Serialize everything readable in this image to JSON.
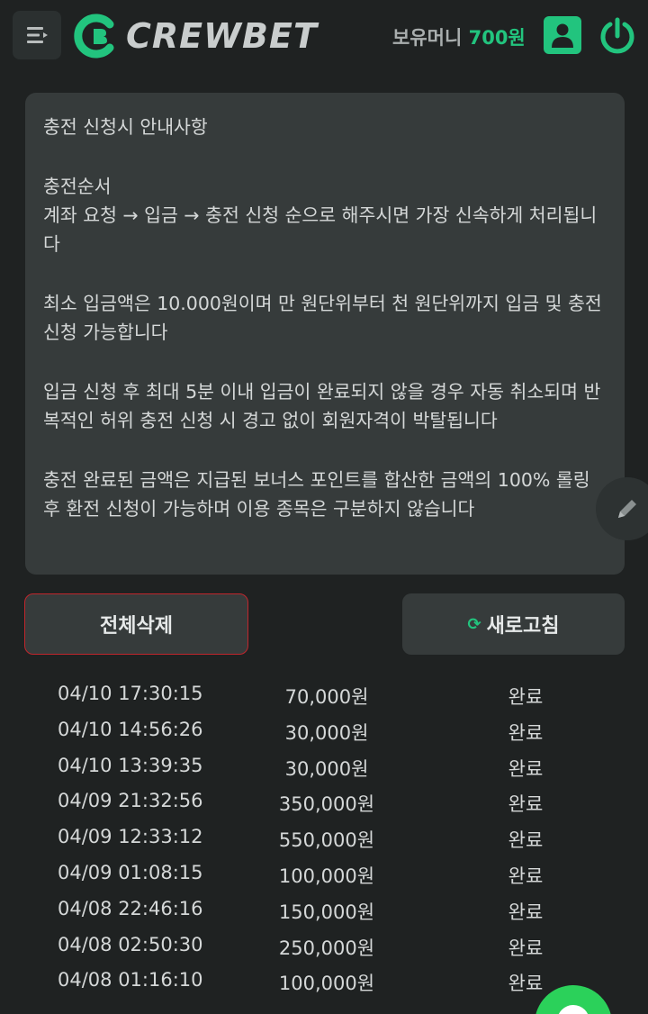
{
  "header": {
    "logo_text": "CREWBET",
    "balance_label": "보유머니",
    "balance_amount": "700원"
  },
  "notice": {
    "title": "충전 신청시 안내사항",
    "section1_title": "충전순서",
    "section1_body": "계좌 요청 → 입금 → 충전 신청 순으로 해주시면 가장 신속하게 처리됩니다",
    "section2_body": "최소 입금액은 10.000원이며 만 원단위부터 천 원단위까지 입금 및 충전 신청 가능합니다",
    "section3_body": "입금 신청 후 최대 5분 이내 입금이 완료되지 않을 경우 자동 취소되며 반복적인 허위 충전 신청 시 경고 없이 회원자격이 박탈됩니다",
    "section4_body": "충전 완료된 금액은 지급된 보너스 포인트를 합산한 금액의 100% 롤링 후 환전 신청이 가능하며 이용 종목은 구분하지 않습니다"
  },
  "actions": {
    "delete_all_label": "전체삭제",
    "refresh_label": "새로고침"
  },
  "history": [
    {
      "time": "04/10 17:30:15",
      "amount": "70,000원",
      "status": "완료"
    },
    {
      "time": "04/10 14:56:26",
      "amount": "30,000원",
      "status": "완료"
    },
    {
      "time": "04/10 13:39:35",
      "amount": "30,000원",
      "status": "완료"
    },
    {
      "time": "04/09 21:32:56",
      "amount": "350,000원",
      "status": "완료"
    },
    {
      "time": "04/09 12:33:12",
      "amount": "550,000원",
      "status": "완료"
    },
    {
      "time": "04/09 01:08:15",
      "amount": "100,000원",
      "status": "완료"
    },
    {
      "time": "04/08 22:46:16",
      "amount": "150,000원",
      "status": "완료"
    },
    {
      "time": "04/08 02:50:30",
      "amount": "250,000원",
      "status": "완료"
    },
    {
      "time": "04/08 01:16:10",
      "amount": "100,000원",
      "status": "완료"
    }
  ],
  "colors": {
    "accent": "#22c47e",
    "danger": "#c0262d",
    "background": "#1f2222",
    "panel": "#363b3b"
  },
  "icons": {
    "menu": "menu-icon",
    "logo": "crewbet-logo-icon",
    "user": "user-icon",
    "power": "power-icon",
    "edit": "pencil-icon",
    "refresh": "refresh-icon",
    "chat": "chat-icon"
  }
}
